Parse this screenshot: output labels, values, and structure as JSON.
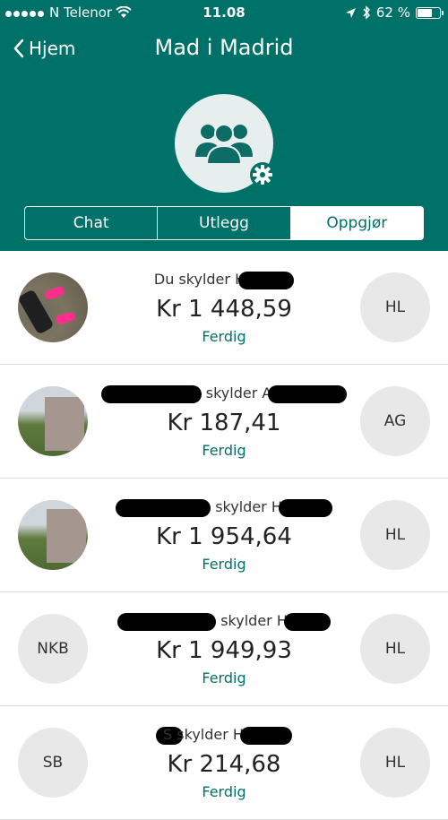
{
  "status_bar": {
    "carrier": "N Telenor",
    "time": "11.08",
    "battery": "62 %",
    "battery_level": 0.62
  },
  "nav": {
    "back_label": "Hjem",
    "title": "Mad i Madrid"
  },
  "tabs": [
    {
      "label": "Chat",
      "active": false
    },
    {
      "label": "Utlegg",
      "active": false
    },
    {
      "label": "Oppgjør",
      "active": true
    }
  ],
  "settlements": [
    {
      "who": "Du skylder H",
      "amount": "Kr 1 448,59",
      "status": "Ferdig",
      "left_avatar": "",
      "right_avatar": "HL"
    },
    {
      "who": "skylder A",
      "amount": "Kr 187,41",
      "status": "Ferdig",
      "left_avatar": "",
      "right_avatar": "AG"
    },
    {
      "who": "skylder H",
      "amount": "Kr 1 954,64",
      "status": "Ferdig",
      "left_avatar": "",
      "right_avatar": "HL"
    },
    {
      "who": "skylder H",
      "amount": "Kr 1 949,93",
      "status": "Ferdig",
      "left_avatar": "NKB",
      "right_avatar": "HL"
    },
    {
      "who": "S skylder H",
      "amount": "Kr 214,68",
      "status": "Ferdig",
      "left_avatar": "SB",
      "right_avatar": "HL"
    }
  ],
  "colors": {
    "primary": "#007168",
    "divider": "#dcdcdc",
    "avatar_bg": "#e8e8e8"
  }
}
